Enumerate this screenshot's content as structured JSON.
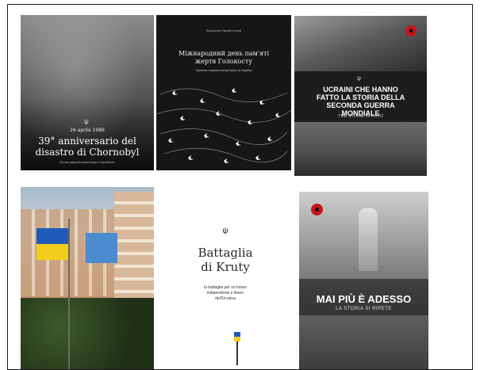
{
  "tiles": {
    "chornobyl": {
      "date": "26 aprile 1986",
      "title_line1": "39° anniversario del",
      "title_line2": "disastro di Chornobyl",
      "footer": "Истоки ядерной катастрофы в Чернобыле"
    },
    "holocaust": {
      "header": "Посольство України в Італії",
      "title_line1": "Міжнародний день пам'яті",
      "title_line2": "жертв Голокосту",
      "subtitle": "Трагічна сторінка історії світу та України"
    },
    "wwii": {
      "title_line1": "UCRAINI CHE HANNO",
      "title_line2": "FATTO LA STORIA DELLA",
      "title_line3": "SECONDA GUERRA",
      "title_line4": "MONDIALE",
      "subtitle": "TRE STORIE IN FOTO"
    },
    "rome": {},
    "kruty": {
      "title_line1": "Battaglia",
      "title_line2": "di Kruty",
      "subtitle_line1": "la battaglia per un futuro",
      "subtitle_line2": "indipendente e libero",
      "subtitle_line3": "dell'Ucraina"
    },
    "maipiu": {
      "title": "MAI PIÙ È ADESSO",
      "subtitle": "LA STORIA SI RIPETE"
    }
  },
  "icons": {
    "trident": "trident-icon",
    "poppy": "poppy-icon"
  },
  "colors": {
    "ua_blue": "#1e5bb8",
    "ua_yellow": "#f2cd1a",
    "poppy_red": "#c4141a"
  }
}
